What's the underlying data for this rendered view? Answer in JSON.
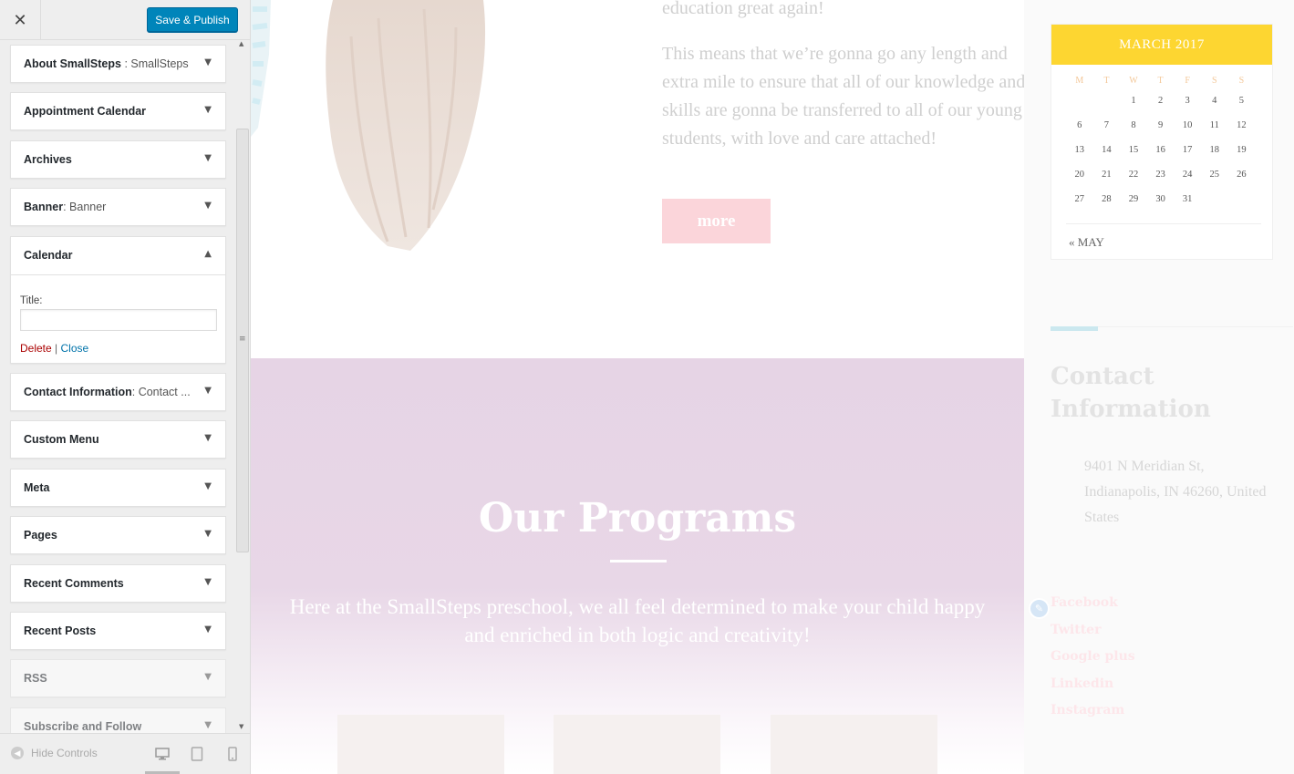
{
  "header": {
    "close_icon": "close-icon",
    "save_label": "Save & Publish"
  },
  "widgets": [
    {
      "title": "About SmallSteps",
      "sub": " : SmallSteps"
    },
    {
      "title": "Appointment Calendar",
      "sub": ""
    },
    {
      "title": "Archives",
      "sub": ""
    },
    {
      "title": "Banner",
      "sub": ": Banner"
    },
    {
      "title": "Calendar",
      "sub": "",
      "expanded": true,
      "field_label": "Title:",
      "field_value": "",
      "delete_label": "Delete",
      "separator": "|",
      "close_label": "Close"
    },
    {
      "title": "Contact Information",
      "sub": ": Contact ..."
    },
    {
      "title": "Custom Menu",
      "sub": ""
    },
    {
      "title": "Meta",
      "sub": ""
    },
    {
      "title": "Pages",
      "sub": ""
    },
    {
      "title": "Recent Comments",
      "sub": ""
    },
    {
      "title": "Recent Posts",
      "sub": ""
    },
    {
      "title": "RSS",
      "sub": ""
    },
    {
      "title": "Subscribe and Follow",
      "sub": ""
    }
  ],
  "footer": {
    "hide_controls_label": "Hide Controls",
    "devices": [
      "desktop-icon",
      "tablet-icon",
      "mobile-icon"
    ]
  },
  "preview": {
    "about_para_1": "education great again!",
    "about_para_2": "This means that we’re gonna go any length and extra mile to ensure that all of our knowledge and skills are gonna be transferred to all of our young students, with love and care attached!",
    "more_label": "more",
    "programs_title": "Our Programs",
    "programs_desc": "Here at the SmallSteps preschool, we all feel determined to make your child happy and enriched in both logic and creativity!",
    "calendar": {
      "month": "MARCH 2017",
      "day_names": [
        "M",
        "T",
        "W",
        "T",
        "F",
        "S",
        "S"
      ],
      "days": [
        "",
        "",
        "1",
        "2",
        "3",
        "4",
        "5",
        "6",
        "7",
        "8",
        "9",
        "10",
        "11",
        "12",
        "13",
        "14",
        "15",
        "16",
        "17",
        "18",
        "19",
        "20",
        "21",
        "22",
        "23",
        "24",
        "25",
        "26",
        "27",
        "28",
        "29",
        "30",
        "31",
        "",
        "",
        ""
      ],
      "prev_link": "« MAY"
    },
    "contact_title": "Contact Information",
    "contact_address": "9401 N Meridian St, Indianapolis, IN 46260, United States",
    "social": [
      "Facebook",
      "Twitter",
      "Google plus",
      "Linkedin",
      "Instagram"
    ]
  },
  "colors": {
    "save_button": "#0085ba",
    "calendar_header": "#fdd631",
    "programs_bg": "#e6d4e5",
    "more_button": "#fbd5da"
  }
}
